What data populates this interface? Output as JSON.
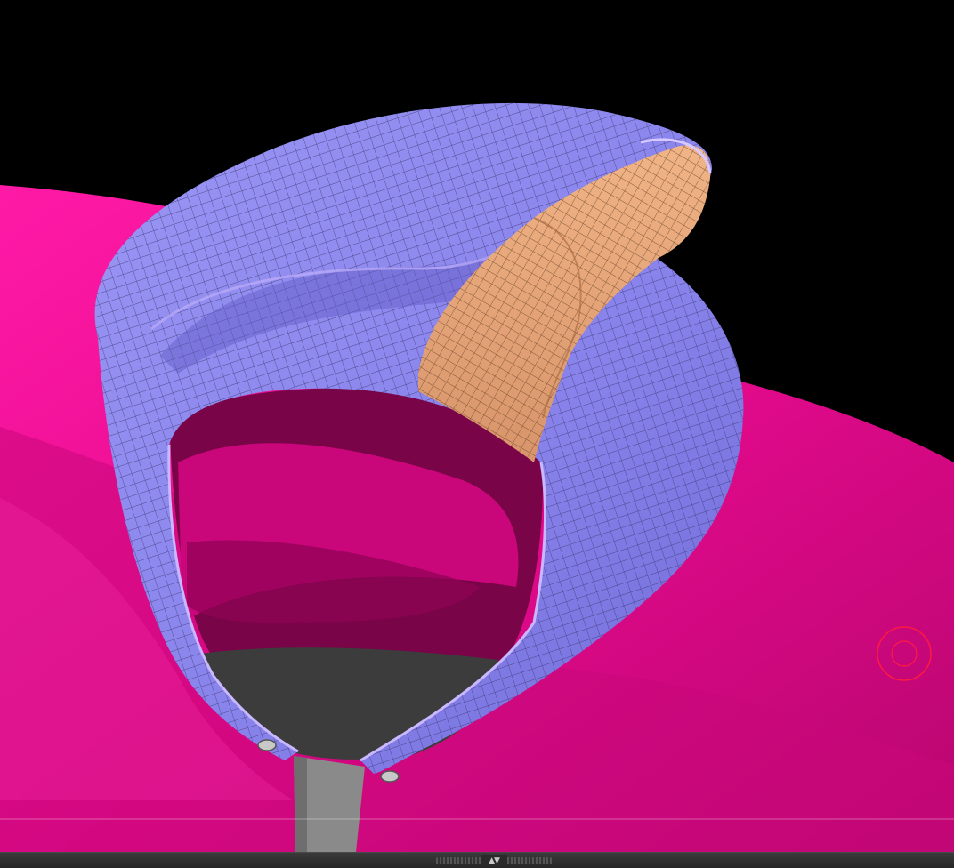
{
  "viewport": {
    "background_color": "#000000",
    "body_color": "#e8088e",
    "hood_outer_color": "#8c88ee",
    "hood_inner_color": "#e8a878",
    "zipper_color": "#8a8a8a",
    "cavity_color": "#3c3c3c",
    "cursor_color": "#ff1a40"
  },
  "bottom_bar": {
    "toggle_icon": "expand-collapse-arrows-icon",
    "toggle_glyph": "▲▼"
  }
}
